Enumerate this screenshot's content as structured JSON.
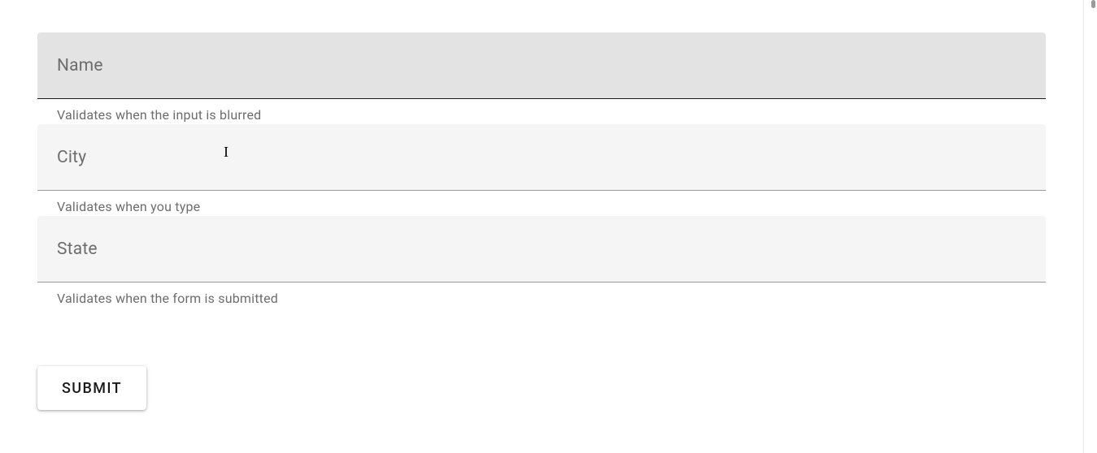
{
  "fields": {
    "name": {
      "label": "Name",
      "value": "",
      "helper": "Validates when the input is blurred"
    },
    "city": {
      "label": "City",
      "value": "",
      "helper": "Validates when you type"
    },
    "state": {
      "label": "State",
      "value": "",
      "helper": "Validates when the form is submitted"
    }
  },
  "submit": {
    "label": "SUBMIT"
  }
}
